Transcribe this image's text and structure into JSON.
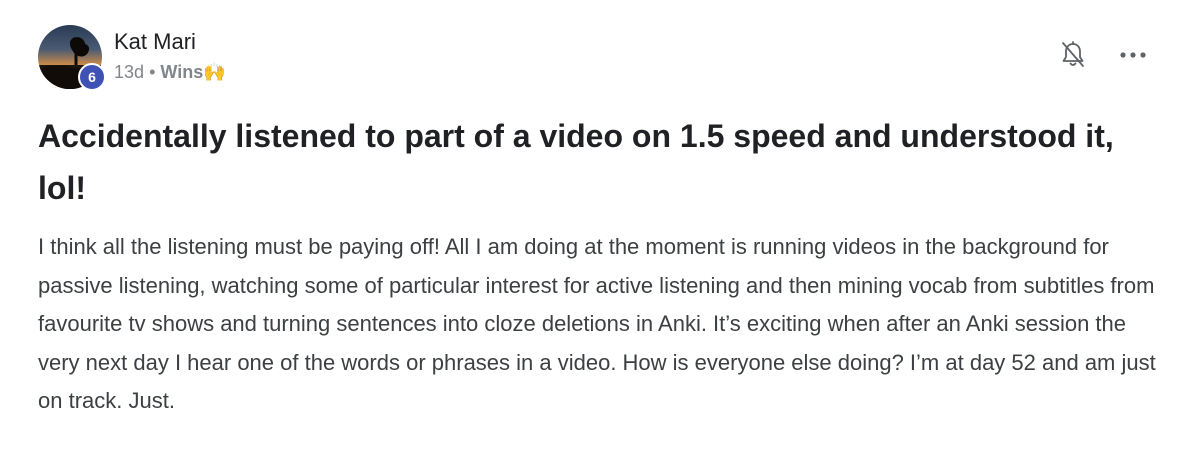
{
  "post": {
    "author": "Kat Mari",
    "level": "6",
    "time_ago": "13d",
    "separator": "•",
    "category": "Wins🙌",
    "title": "Accidentally listened to part of a video on 1.5 speed and understood it, lol!",
    "body": "I think all the listening must be paying off! All I am doing at the moment is running videos in the background for passive listening, watching some of particular interest for active listening and then mining vocab from subtitles from favourite tv shows and turning sentences into cloze deletions in Anki. It’s exciting when after an Anki session the very next day I hear one of the words or phrases in a video. How is everyone else doing? I’m at day 52 and am just on track. Just."
  },
  "icons": {
    "notification": "bell-off-icon",
    "more": "more-horizontal-icon"
  },
  "colors": {
    "badge": "#3f51b5",
    "muted": "#80868b",
    "text": "#202124"
  }
}
